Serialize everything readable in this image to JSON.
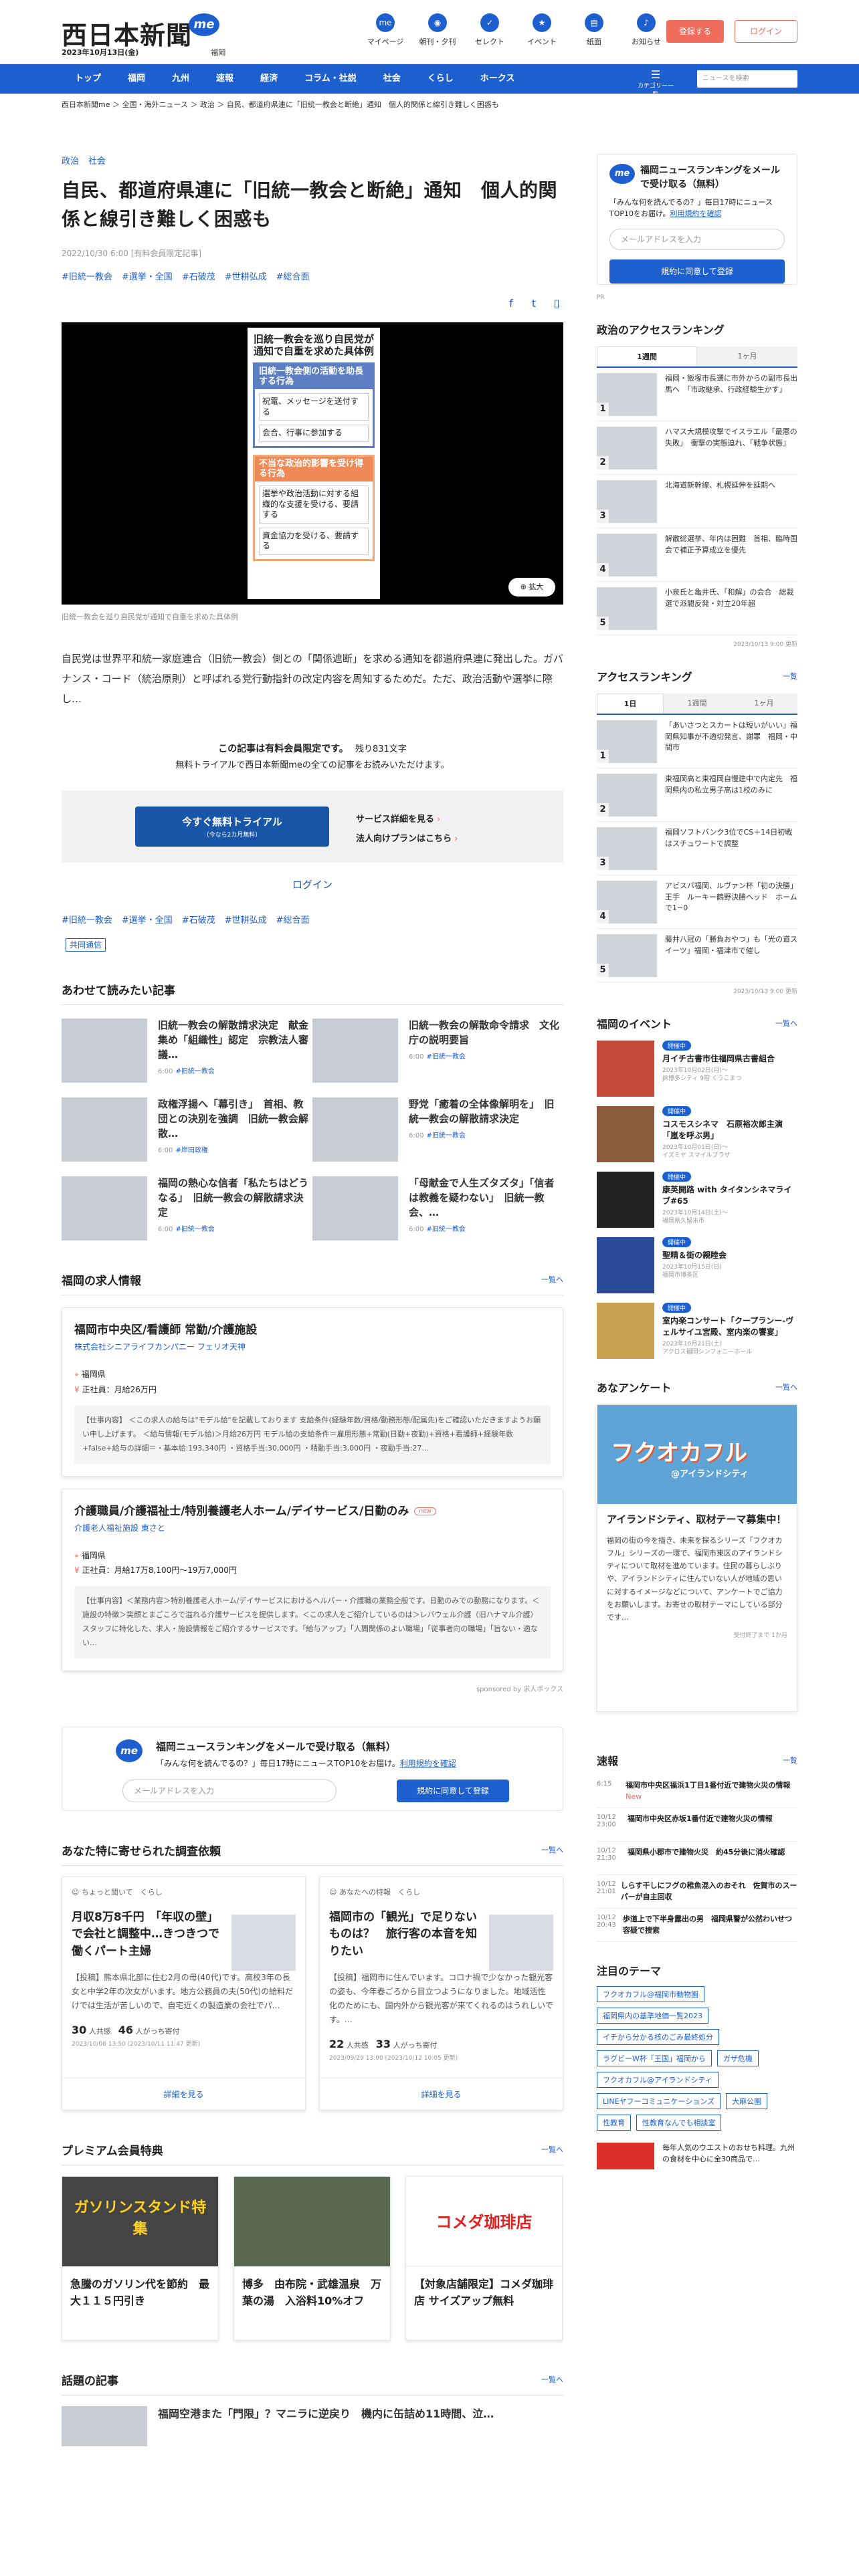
{
  "header": {
    "logo": "西日本新聞",
    "me_badge": "me",
    "date": "2023年10月13日(金)",
    "pref": "福岡",
    "icons": [
      {
        "icon": "me-icon",
        "glyph": "me",
        "label": "マイページ"
      },
      {
        "icon": "newspaper-icon",
        "glyph": "◉",
        "label": "朝刊・夕刊"
      },
      {
        "icon": "select-icon",
        "glyph": "✓",
        "label": "セレクト"
      },
      {
        "icon": "event-icon",
        "glyph": "★",
        "label": "イベント"
      },
      {
        "icon": "paper-icon",
        "glyph": "▤",
        "label": "紙面"
      },
      {
        "icon": "bell-icon",
        "glyph": "♪",
        "label": "お知らせ"
      }
    ],
    "register": "登録する",
    "login": "ログイン"
  },
  "nav": {
    "items": [
      "トップ",
      "福岡",
      "九州",
      "速報",
      "経済",
      "コラム・社説",
      "社会",
      "くらし",
      "ホークス"
    ],
    "menu": "カテゴリー一覧",
    "search_placeholder": "ニュースを検索"
  },
  "breadcrumb": "西日本新聞me ＞ 全国・海外ニュース ＞ 政治 ＞ 自民、都道府県連に「旧統一教会と断絶」通知　個人的関係と線引き難しく困惑も",
  "article": {
    "categories": [
      "政治",
      "社会"
    ],
    "title": "自民、都道府県連に「旧統一教会と断絶」通知　個人的関係と線引き難しく困惑も",
    "meta": "2022/10/30 6:00 [有料会員限定記事]",
    "tags": [
      "#旧統一教会",
      "#選挙・全国",
      "#石破茂",
      "#世耕弘成",
      "#総合面"
    ],
    "infographic": {
      "title": "旧統一教会を巡り自民党が通知で自重を求めた具体例",
      "box1_head": "旧統一教会側の活動を助長する行為",
      "box1_items": [
        "祝電、メッセージを送付する",
        "会合、行事に参加する"
      ],
      "box2_head": "不当な政治的影響を受け得る行為",
      "box2_items": [
        "選挙や政治活動に対する組織的な支援を受ける、要請する",
        "資金協力を受ける、要請する"
      ]
    },
    "zoom": "拡大",
    "caption": "旧統一教会を巡り自民党が通知で自重を求めた具体例",
    "lead": "自民党は世界平和統一家庭連合（旧統一教会）側との「関係遮断」を求める通知を都道府県連に発出した。ガバナンス・コード（統治原則）と呼ばれる党行動指針の改定内容を周知するためだ。ただ、政治活動や選挙に際し…",
    "paywall_title": "この記事は有料会員限定です。",
    "paywall_remaining": "残り831文字",
    "paywall_sub": "無料トライアルで西日本新聞meの全ての記事をお読みいただけます。",
    "trial_button": "今すぐ無料トライアル",
    "trial_sub": "（今なら2カ月無料）",
    "service_link": "サービス詳細を見る",
    "corp_link": "法人向けプランはこちら",
    "login_link": "ログイン",
    "kyodo_label": "共同通信"
  },
  "related": {
    "title": "あわせて読みたい記事",
    "items": [
      {
        "title": "旧統一教会の解散請求決定　献金集め「組織性」認定　宗教法人審議…",
        "date": "6:00",
        "tag": "#旧統一教会"
      },
      {
        "title": "旧統一教会の解散命令請求　文化庁の説明要旨",
        "date": "6:00",
        "tag": "#旧統一教会"
      },
      {
        "title": "政権浮揚へ「幕引き」　首相、教団との決別を強調　旧統一教会解散…",
        "date": "6:00",
        "tag": "#岸田政権"
      },
      {
        "title": "野党「癒着の全体像解明を」　旧統一教会の解散請求決定",
        "date": "6:00",
        "tag": "#旧統一教会"
      },
      {
        "title": "福岡の熱心な信者「私たちはどうなる」　旧統一教会の解散請求決定",
        "date": "6:00",
        "tag": "#旧統一教会"
      },
      {
        "title": "「母献金で人生ズタズタ」「信者は教義を疑わない」　旧統一教会、…",
        "date": "6:00",
        "tag": "#旧統一教会"
      }
    ]
  },
  "jobs": {
    "title": "福岡の求人情報",
    "more": "一覧へ",
    "items": [
      {
        "title": "福岡市中央区/看護師 常勤/介護施設",
        "company": "株式会社シニアライフカンパニー フェリオ天神",
        "new": "",
        "location": "福岡県",
        "salary": "正社員：月給26万円",
        "desc": "【仕事内容】 ＜この求人の給与は\"モデル給\"を記載しております 支給条件(経験年数/資格/勤務形態/配属先)をご確認いただきますようお願い申し上げます。 ＜給与情報(モデル給)＞月給26万円 モデル給の支給条件＝雇用形態+常勤(日勤+夜勤)+資格+看護師+経験年数+false+給与の詳細＝・基本給:193,340円 ・資格手当:30,000円 ・精勤手当:3,000円 ・夜勤手当:27…"
      },
      {
        "title": "介護職員/介護福祉士/特別養護老人ホーム/デイサービス/日勤のみ",
        "company": "介護老人福祉施設 東さと",
        "new": "new",
        "location": "福岡県",
        "salary": "正社員：月給17万8,100円〜19万7,000円",
        "desc": "【仕事内容】＜業務内容＞特別養護老人ホーム/デイサービスにおけるヘルパー・介護職の業務全般です。日勤のみでの勤務になります。＜施設の特徴＞笑顔とまごころで溢れる介護サービスを提供します。＜この求人をご紹介しているのは＞レバウェル介護（旧ハナマル介護）スタッフに特化した、求人・施設情報をご紹介するサービスです。「給与アップ」「人間関係のよい職場」「従事者向の職場」「旨ない・適ない…"
      }
    ],
    "sponsor": "sponsored by 求人ボックス"
  },
  "mail": {
    "badge": "me",
    "title": "福岡ニュースランキングをメールで受け取る（無料）",
    "sub": "「みんな何を読んでるの？」毎日17時にニュースTOP10をお届け。",
    "policy": "利用規約を確認",
    "placeholder": "メールアドレスを入力",
    "button": "規約に同意して登録"
  },
  "surveys": {
    "title": "あなた特に寄せられた調査依頼",
    "more": "一覧へ",
    "items": [
      {
        "tag": "ちょっと聞いて　くらし",
        "title": "月収8万8千円　「年収の壁」で会社と調整中…きつきつで働くパート主婦",
        "body": "【投稿】熊本県北部に住む2月の母(40代)です。高校3年の長女と中学2年の次女がいます。地方公務員の夫(50代)の給料だけでは生活が苦しいので、自宅近くの製造業の会社でパ…",
        "c1": "30",
        "c1l": "人共感",
        "c2": "46",
        "c2l": "人がっち寄付",
        "date": "2023/10/06 13:50 (2023/10/11 11:47 更新)",
        "link": "詳細を見る"
      },
      {
        "tag": "あなたへの特報　くらし",
        "title": "福岡市の「観光」で足りないものは？　旅行客の本音を知りたい",
        "body": "【投稿】福岡市に住んでいます。コロナ禍で少なかった観光客の姿も、今年春ごろから目立つようになりました。地域活性化のためにも、国内外から観光客が来てくれるのはうれしいです。…",
        "c1": "22",
        "c1l": "人共感",
        "c2": "33",
        "c2l": "人がっち寄付",
        "date": "2023/09/29 13:00 (2023/10/12 10:05 更新)",
        "link": "詳細を見る"
      }
    ]
  },
  "premium": {
    "title": "プレミアム会員特典",
    "more": "一覧へ",
    "items": [
      {
        "title": "急騰のガソリン代を節約　最大１１５円引き",
        "img_text": "ガソリンスタンド特集"
      },
      {
        "title": "博多　由布院・武雄温泉　万葉の湯　入浴料10%オフ",
        "img_text": ""
      },
      {
        "title": "【対象店舗限定】コメダ珈琲店 サイズアップ無料",
        "img_text": "コメダ珈琲店"
      }
    ]
  },
  "topics": {
    "title": "話題の記事",
    "more": "一覧へ",
    "first": "福岡空港また「門限」？マニラに逆戻り　機内に缶詰め11時間、泣…"
  },
  "sidebar": {
    "mail_title": "福岡ニュースランキングをメールで受け取る（無料）",
    "mail_sub": "「みんな何を読んでるの？」毎日17時にニュースTOP10をお届け。",
    "mail_policy": "利用規約を確認",
    "mail_placeholder": "メールアドレスを入力",
    "mail_button": "規約に同意して登録",
    "ad": "PR",
    "politics_title": "政治のアクセスランキング",
    "politics_tabs": [
      "1週間",
      "1ヶ月"
    ],
    "politics": [
      "福岡・飯塚市長選に市外からの副市長出馬へ　「市政継承、行政経験生かす」",
      "ハマス大規模攻撃でイスラエル「最悪の失敗」　衝撃の実態迫れ、「戦争状態」",
      "北海道新幹線、札幌延伸を延期へ",
      "解散総選挙、年内は困難　首相、臨時国会で補正予算成立を優先",
      "小泉氏と亀井氏、「和解」の会合　総裁選で派閥反発・対立20年超"
    ],
    "politics_date": "2023/10/13 9:00 更新",
    "access_title": "アクセスランキング",
    "access_more": "一覧",
    "access_tabs": [
      "1日",
      "1週間",
      "1ヶ月"
    ],
    "access": [
      "「あいさつとスカートは短いがいい」福岡県知事が不適切発言、謝罪　福岡・中間市",
      "東福岡高と東福岡自慢建中で内定先　福岡県内の私立男子高は1校のみに",
      "福岡ソフトバンク3位でCS＋14日初戦はスチュワートで調整",
      "アビスパ福岡、ルヴァン杯「初の決勝」王手　ルーキー鶴野決勝ヘッド　ホームで1−0",
      "藤井八冠の「勝負おやつ」も「光の道スイーツ」福岡・福津市で催し"
    ],
    "access_date": "2023/10/13 9:00 更新",
    "events_title": "福岡のイベント",
    "events_more": "一覧へ",
    "events": [
      {
        "badge": "開催中",
        "title": "月イチ古書市住福岡県古書組合",
        "d1": "2023年10月02日(月)〜",
        "d2": "JR博多シティ 9階 くうこまつ"
      },
      {
        "badge": "開催中",
        "title": "コスモスシネマ　石原裕次郎主演「嵐を呼ぶ男」",
        "d1": "2023年10月01日(日)〜",
        "d2": "イズミヤ スマイルプラザ"
      },
      {
        "badge": "開催中",
        "title": "康英開路 with タイタンシネマライブ#65",
        "d1": "2023年10月14日(土)〜",
        "d2": "福岡県久留米市"
      },
      {
        "badge": "開催中",
        "title": "聖精＆街の親睦会",
        "d1": "2023年10月15日(日)",
        "d2": "福岡市博多区"
      },
      {
        "badge": "開催中",
        "title": "室内楽コンサート「クープランー-ヴェルサイユ宮殿、室内楽の饗宴」",
        "d1": "2023年10月21日(土)",
        "d2": "アクロス福岡シンフォニーホール"
      }
    ],
    "enquete_title": "あなアンケート",
    "enquete_more": "一覧へ",
    "enquete_img": "フクオカフル",
    "enquete_img_sub": "@アイランドシティ",
    "enquete_head": "アイランドシティ、取材テーマ募集中！",
    "enquete_body": "福岡の街の今を描き、未来を探るシリーズ「フクオカフル」シリーズの一環で、福岡市東区のアイランドシティについて取材を進めています。住民の暮らしぶりや、アイランドシティに住んでいない人が地域の思いに対するイメージなどについて、アンケートでご協力をお願いします。お寄せの取材テーマにしている部分です…",
    "enquete_date": "受付終了まで 1か月",
    "quick_title": "速報",
    "quick_more": "一覧",
    "quick": [
      {
        "time": "6:15",
        "text": "福岡市中央区福浜1丁目1番付近で建物火災の情報",
        "new": "New"
      },
      {
        "time": "10/12 23:00",
        "text": "福岡市中央区赤坂1番付近で建物火災の情報",
        "new": ""
      },
      {
        "time": "10/12 21:30",
        "text": "福岡県小郡市で建物火災　約45分後に消火確認",
        "new": ""
      },
      {
        "time": "10/12 21:01",
        "text": "しらす干しにフグの稚魚混入のおそれ　佐賀市のスーパーが自主回収",
        "new": ""
      },
      {
        "time": "10/12 20:43",
        "text": "歩道上で下半身露出の男　福岡県警が公然わいせつ容疑で捜索",
        "new": ""
      }
    ],
    "themes_title": "注目のテーマ",
    "themes": [
      "フクオカフル@福岡市動物園",
      "福岡県内の基準地価一覧2023",
      "イチから分かる核のごみ最終処分",
      "ラグビーW杯「王国」福岡から",
      "ガザ危機",
      "フクオカフル@アイランドシティ",
      "LINEヤフーコミュニケーションズ",
      "大麻公園",
      "性教育",
      "性教育なんでも相談室"
    ],
    "sugg_text": "毎年人気のウエストのおせち料理。九州の食材を中心に全30商品で…"
  },
  "colors": {
    "brand": "#1e5fcf",
    "accent": "#ef6b5b"
  }
}
